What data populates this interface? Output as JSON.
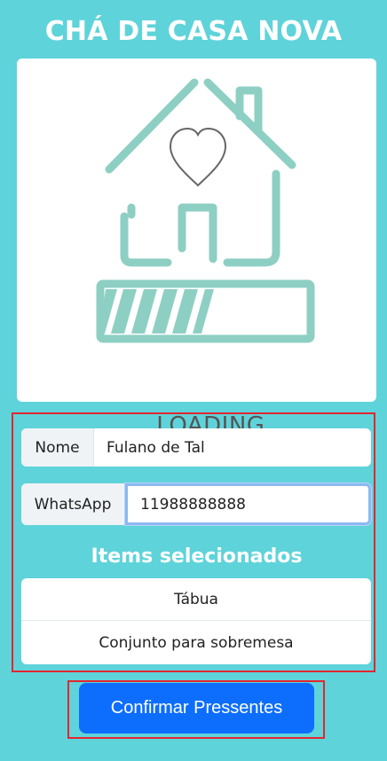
{
  "header": {
    "title": "CHÁ DE CASA NOVA"
  },
  "hero_image": {
    "caption": "LOADING...",
    "icon": "house-heart-loading-illustration"
  },
  "form": {
    "name_label": "Nome",
    "name_value": "Fulano de Tal",
    "whatsapp_label": "WhatsApp",
    "whatsapp_value": "11988888888"
  },
  "selected": {
    "title": "Items selecionados",
    "items": [
      "Tábua",
      "Conjunto para sobremesa"
    ]
  },
  "actions": {
    "confirm_label": "Confirmar Pressentes"
  },
  "colors": {
    "background": "#5fd3da",
    "primary_button": "#0d6efd",
    "illustration": "#8ecfc3",
    "highlight": "#e3262f"
  }
}
